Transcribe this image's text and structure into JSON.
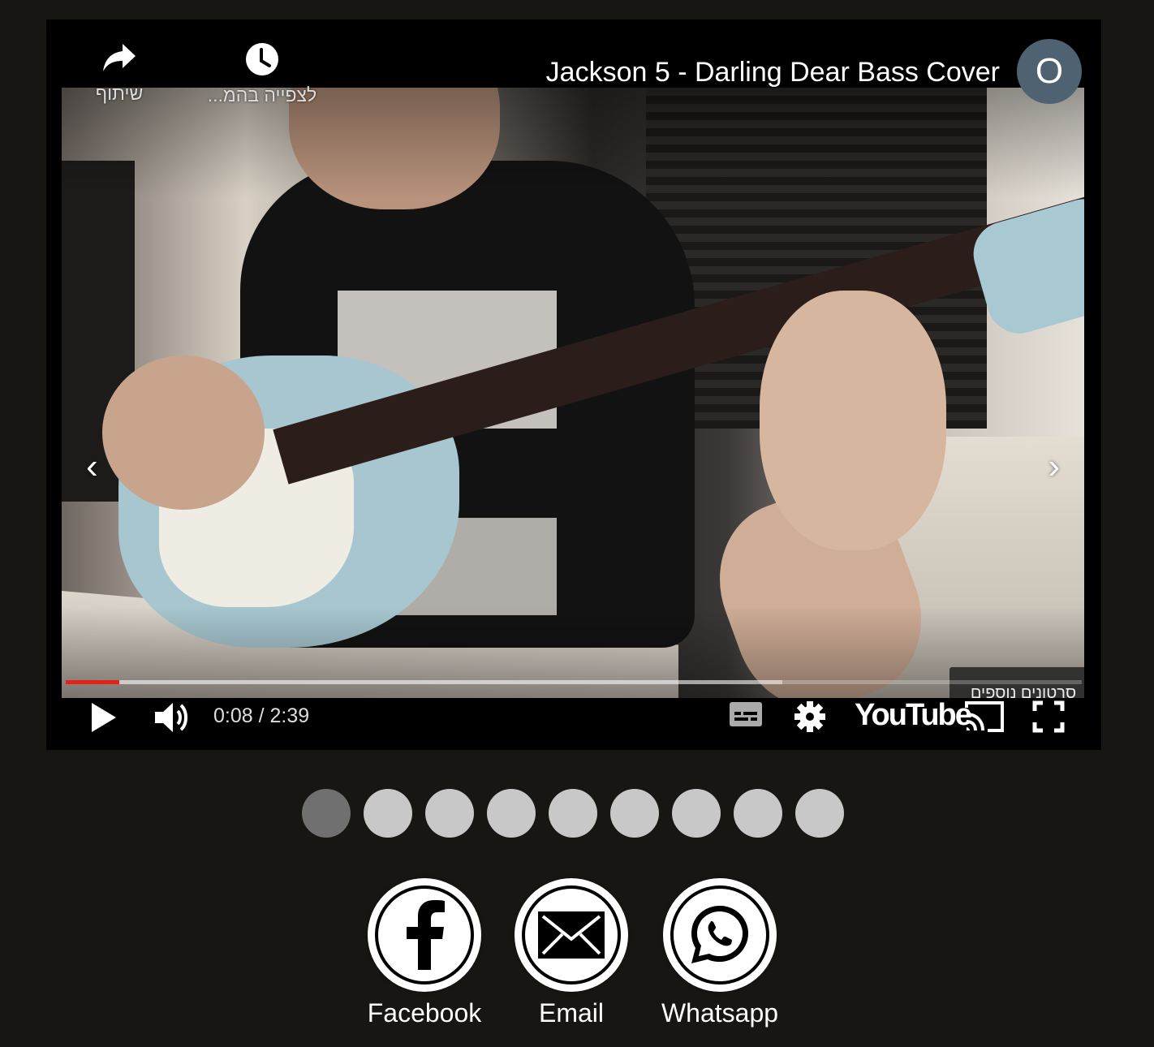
{
  "video": {
    "title": "Jackson 5 - Darling Dear Bass Cover",
    "channel_initial": "O",
    "share_label": "שיתוף",
    "watch_later_label": "לצפייה בהמ...",
    "more_videos_label": "סרטונים נוספים",
    "time_display": "0:08 / 2:39",
    "progress_played_fraction": 0.053,
    "progress_buffered_fraction": 0.705,
    "prev_arrow": "‹",
    "next_arrow": "›",
    "brand": "YouTube",
    "icons": [
      "share-icon",
      "clock-icon",
      "play-icon",
      "volume-icon",
      "subtitles-icon",
      "settings-gear-icon",
      "cast-icon",
      "fullscreen-icon"
    ]
  },
  "carousel": {
    "dot_count": 9,
    "active_index": 0
  },
  "share": {
    "items": [
      {
        "label": "Facebook",
        "icon": "facebook-icon"
      },
      {
        "label": "Email",
        "icon": "envelope-icon"
      },
      {
        "label": "Whatsapp",
        "icon": "whatsapp-icon"
      }
    ]
  },
  "colors": {
    "page_bg": "#181612",
    "progress_played": "#e62117",
    "avatar_bg": "#4e6272",
    "dot": "#c8c8c8",
    "dot_active": "#707070"
  }
}
